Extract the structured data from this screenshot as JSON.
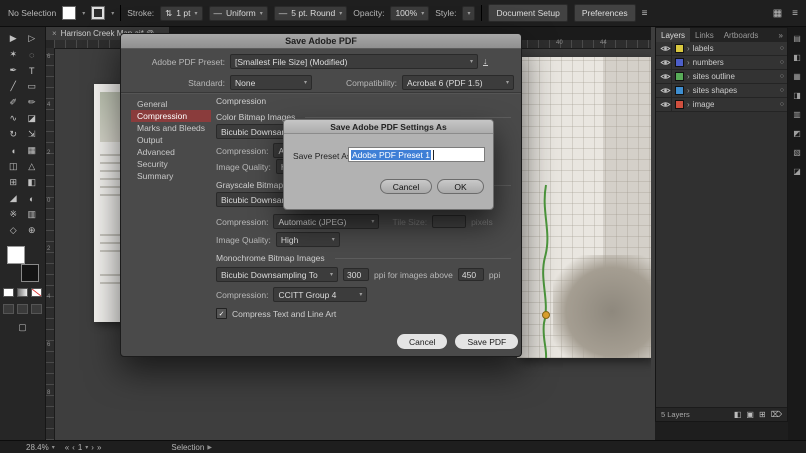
{
  "colors": {
    "sidebar_selected": "#8a3c3c",
    "text_selection_bg": "#3e7fd6",
    "creek_green": "#4e9a3e",
    "marker_orange": "#e2a52f"
  },
  "icons": {
    "caret": "▾",
    "close": "×",
    "stepper": "⇅",
    "download": "↓",
    "chevron": "›",
    "target": "○",
    "collapse": "»",
    "menu": "≡",
    "grid": "▦",
    "dash": "—",
    "check": "✓",
    "nav_first": "«",
    "nav_prev": "‹",
    "nav_next": "›",
    "nav_last": "»",
    "arrow_right": "▶",
    "screen_mode": "▢",
    "mask": "◧",
    "sublayer": "▣",
    "new_layer": "⊞",
    "delete": "⌦"
  },
  "topbar": {
    "selection_status": "No Selection",
    "stroke_label": "Stroke:",
    "stroke_value": "1 pt",
    "brush_value": "Uniform",
    "profile_value": "5 pt. Round",
    "opacity_label": "Opacity:",
    "opacity_value": "100%",
    "style_label": "Style:",
    "document_setup_label": "Document Setup",
    "preferences_label": "Preferences"
  },
  "tools": {
    "items": [
      {
        "name": "selection",
        "glyph": "▶"
      },
      {
        "name": "direct-selection",
        "glyph": "▷"
      },
      {
        "name": "magic-wand",
        "glyph": "✶"
      },
      {
        "name": "lasso",
        "glyph": "◌"
      },
      {
        "name": "pen",
        "glyph": "✒"
      },
      {
        "name": "type",
        "glyph": "T"
      },
      {
        "name": "line-segment",
        "glyph": "╱"
      },
      {
        "name": "rectangle",
        "glyph": "▭"
      },
      {
        "name": "paintbrush",
        "glyph": "✐"
      },
      {
        "name": "pencil",
        "glyph": "✏"
      },
      {
        "name": "shaper",
        "glyph": "∿"
      },
      {
        "name": "eraser",
        "glyph": "◪"
      },
      {
        "name": "rotate",
        "glyph": "↻"
      },
      {
        "name": "scale",
        "glyph": "⇲"
      },
      {
        "name": "width",
        "glyph": "◖"
      },
      {
        "name": "free-transform",
        "glyph": "▦"
      },
      {
        "name": "shape-builder",
        "glyph": "◫"
      },
      {
        "name": "perspective-grid",
        "glyph": "△"
      },
      {
        "name": "mesh",
        "glyph": "⊞"
      },
      {
        "name": "gradient",
        "glyph": "◧"
      },
      {
        "name": "eyedropper",
        "glyph": "◢"
      },
      {
        "name": "blend",
        "glyph": "◐"
      },
      {
        "name": "symbol-sprayer",
        "glyph": "※"
      },
      {
        "name": "column-graph",
        "glyph": "▥"
      },
      {
        "name": "hand",
        "glyph": "◇"
      },
      {
        "name": "zoom",
        "glyph": "⊕"
      }
    ]
  },
  "tabbar": {
    "doc_title": "Harrison Creek Map.ai* @ ..."
  },
  "rulers": {
    "h": [
      "0",
      "40",
      "44"
    ],
    "v": [
      "6",
      "4",
      "2",
      "0",
      "2",
      "4",
      "6",
      "8"
    ]
  },
  "pdf_dialog": {
    "title": "Save Adobe PDF",
    "preset_label": "Adobe PDF Preset:",
    "preset_value": "[Smallest File Size] (Modified)",
    "standard_label": "Standard:",
    "standard_value": "None",
    "compatibility_label": "Compatibility:",
    "compatibility_value": "Acrobat 6 (PDF 1.5)",
    "sidebar": [
      {
        "label": "General"
      },
      {
        "label": "Compression"
      },
      {
        "label": "Marks and Bleeds"
      },
      {
        "label": "Output"
      },
      {
        "label": "Advanced"
      },
      {
        "label": "Security"
      },
      {
        "label": "Summary"
      }
    ],
    "heading": "Compression",
    "color_section": {
      "title": "Color Bitmap Images",
      "resample_value": "Bicubic Downsampling To",
      "compression_label": "Compression:",
      "compression_value": "Automatic (JPEG)",
      "quality_label": "Image Quality:",
      "quality_value": "High"
    },
    "gray_section": {
      "title": "Grayscale Bitmap Images",
      "resample_value": "Bicubic Downsampling To",
      "compression_label": "Compression:",
      "compression_value": "Automatic (JPEG)",
      "tile_label": "Tile Size:",
      "tile_value": "",
      "tile_suffix": "pixels",
      "quality_label": "Image Quality:",
      "quality_value": "High"
    },
    "mono_section": {
      "title": "Monochrome Bitmap Images",
      "resample_value": "Bicubic Downsampling To",
      "ppi_value": "300",
      "between_text": "ppi for images above",
      "threshold_value": "450",
      "ppi_suffix": "ppi",
      "compression_label": "Compression:",
      "compression_value": "CCITT Group 4"
    },
    "compress_text_label": "Compress Text and Line Art",
    "cancel_label": "Cancel",
    "save_label": "Save PDF"
  },
  "preset_dialog": {
    "title": "Save Adobe PDF Settings As",
    "field_label": "Save Preset As:",
    "field_value": "Adobe PDF Preset 1",
    "cancel_label": "Cancel",
    "ok_label": "OK"
  },
  "layers_panel": {
    "tabs": [
      {
        "label": "Layers"
      },
      {
        "label": "Links"
      },
      {
        "label": "Artboards"
      }
    ],
    "items": [
      {
        "name": "labels",
        "color": "#d9c83f"
      },
      {
        "name": "numbers",
        "color": "#4d5fc9"
      },
      {
        "name": "sites outline",
        "color": "#58ab58"
      },
      {
        "name": "sites shapes",
        "color": "#3e8ed0"
      },
      {
        "name": "image",
        "color": "#cf4f3e"
      }
    ],
    "status": "5 Layers"
  },
  "farstrip": {
    "items": [
      {
        "glyph": "▤"
      },
      {
        "glyph": "◧"
      },
      {
        "glyph": "▦"
      },
      {
        "glyph": "◨"
      },
      {
        "glyph": "▥"
      },
      {
        "glyph": "◩"
      },
      {
        "glyph": "▧"
      },
      {
        "glyph": "◪"
      }
    ]
  },
  "statusbar": {
    "zoom": "28.4%",
    "artboard": "1",
    "tool_label": "Selection"
  }
}
